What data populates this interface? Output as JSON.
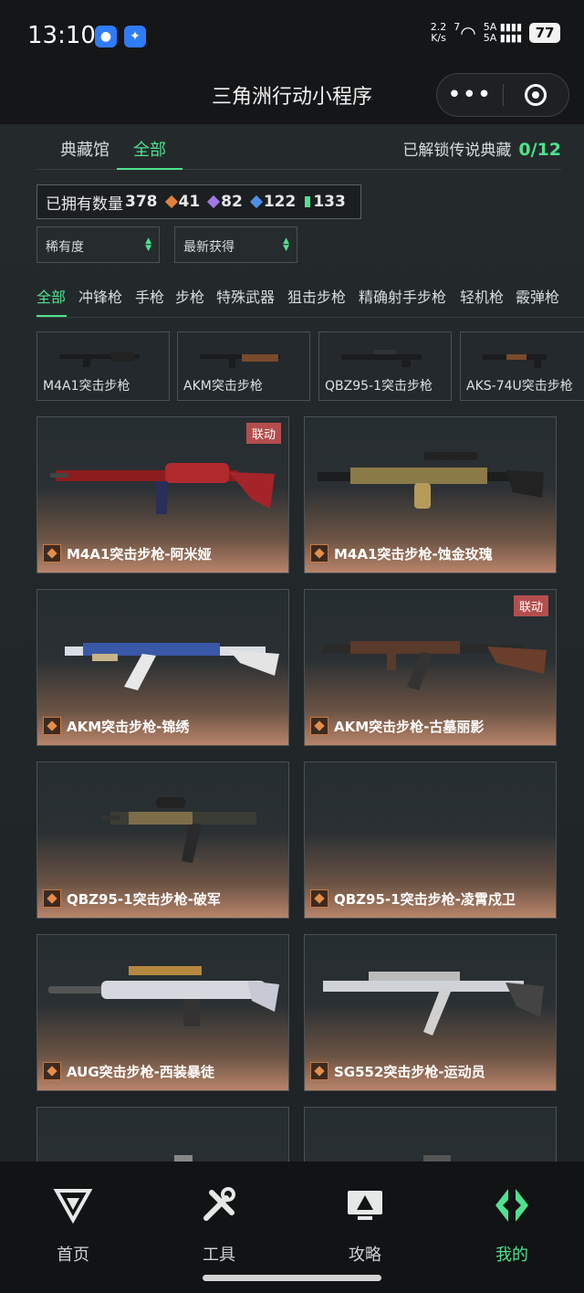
{
  "status_bar": {
    "time": "13:10",
    "net_speed_value": "2.2",
    "net_speed_unit": "K/s",
    "wifi_label": "7",
    "signal_1": "5A",
    "signal_2": "5A",
    "battery": "77"
  },
  "header": {
    "title": "三角洲行动小程序",
    "more_icon": "•••"
  },
  "top_tabs": [
    {
      "label": "典藏馆"
    },
    {
      "label": "全部"
    }
  ],
  "unlock": {
    "label": "已解锁传说典藏",
    "count": "0/12"
  },
  "owned": {
    "label": "已拥有数量",
    "total": "378",
    "tiers": [
      {
        "value": "41",
        "color": "#e1813f"
      },
      {
        "value": "82",
        "color": "#a277e6"
      },
      {
        "value": "122",
        "color": "#4f8fe6"
      },
      {
        "value": "133",
        "color": "#4ee28e"
      }
    ]
  },
  "filters": [
    {
      "label": "稀有度"
    },
    {
      "label": "最新获得"
    }
  ],
  "categories": [
    "全部",
    "冲锋枪",
    "手枪",
    "步枪",
    "特殊武器",
    "狙击步枪",
    "精确射手步枪",
    "轻机枪",
    "霰弹枪"
  ],
  "weapon_strip": [
    "M4A1突击步枪",
    "AKM突击步枪",
    "QBZ95-1突击步枪",
    "AKS-74U突击步枪"
  ],
  "skins": [
    {
      "name": "M4A1突击步枪-阿米娅",
      "tag": "联动"
    },
    {
      "name": "M4A1突击步枪-蚀金玫瑰",
      "tag": ""
    },
    {
      "name": "AKM突击步枪-锦绣",
      "tag": ""
    },
    {
      "name": "AKM突击步枪-古墓丽影",
      "tag": "联动"
    },
    {
      "name": "QBZ95-1突击步枪-破军",
      "tag": ""
    },
    {
      "name": "QBZ95-1突击步枪-凌霄戍卫",
      "tag": ""
    },
    {
      "name": "AUG突击步枪-西装暴徒",
      "tag": ""
    },
    {
      "name": "SG552突击步枪-运动员",
      "tag": ""
    }
  ],
  "bottom_nav": [
    {
      "label": "首页",
      "icon": "delta-logo-icon"
    },
    {
      "label": "工具",
      "icon": "tools-icon"
    },
    {
      "label": "攻略",
      "icon": "guide-monitor-icon"
    },
    {
      "label": "我的",
      "icon": "profile-logo-icon"
    }
  ],
  "colors": {
    "accent": "#4ee28e",
    "tag": "#b44e4e",
    "legend_gem": "#e1813f"
  }
}
